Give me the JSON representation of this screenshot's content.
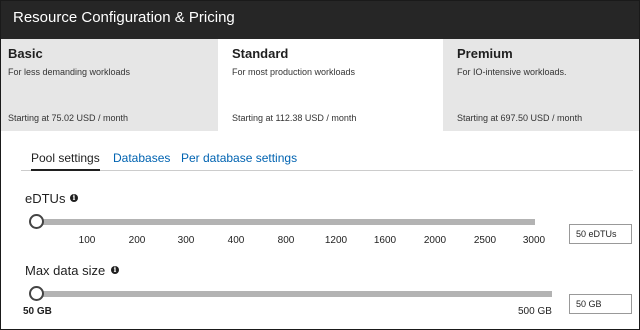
{
  "window": {
    "title": "Resource Configuration & Pricing"
  },
  "tiers": [
    {
      "name": "Basic",
      "description": "For less demanding workloads",
      "price": "Starting at 75.02 USD / month",
      "selected": false
    },
    {
      "name": "Standard",
      "description": "For most production workloads",
      "price": "Starting at 112.38 USD / month",
      "selected": true
    },
    {
      "name": "Premium",
      "description": "For IO-intensive workloads.",
      "price": "Starting at 697.50 USD / month",
      "selected": false
    }
  ],
  "tabs": [
    {
      "label": "Pool settings",
      "active": true
    },
    {
      "label": "Databases",
      "active": false
    },
    {
      "label": "Per database settings",
      "active": false
    }
  ],
  "edtu": {
    "label": "eDTUs",
    "info_icon": "info-icon",
    "ticks": [
      "100",
      "200",
      "300",
      "400",
      "800",
      "1200",
      "1600",
      "2000",
      "2500",
      "3000"
    ],
    "value": "50 eDTUs",
    "slider_fraction": 0
  },
  "max_data_size": {
    "label": "Max data size",
    "info_icon": "info-icon",
    "min_label": "50 GB",
    "max_label": "500 GB",
    "value": "50 GB",
    "slider_fraction": 0
  },
  "colors": {
    "titlebar": "#262626",
    "unselected_tier": "#e6e6e6",
    "link": "#0063b1",
    "track": "#b3b3b3"
  }
}
